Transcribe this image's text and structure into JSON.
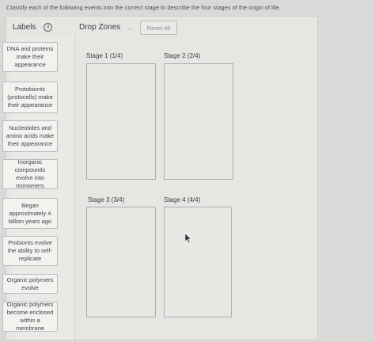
{
  "instructions": "Classify each of the following events into the correct stage to describe the four stages of the origin of life.",
  "labels_panel": {
    "title": "Labels",
    "info_glyph": "i"
  },
  "drop_panel": {
    "title": "Drop Zones",
    "back_glyph": "←",
    "reset_label": "Reset All"
  },
  "labels": [
    "DNA and proteins make their appearance",
    "Protobionts (protocells) make their appearance",
    "Nucleotides and amino acids make their appearance",
    "Inorganic compounds evolve into monomers",
    "Began approximately 4 billion years ago",
    "Probionts evolve the ability to self-replicate",
    "Organic polymers evolve",
    "Organic polymers become enclosed within a membrane"
  ],
  "stages": [
    {
      "label": "Stage 1 (1/4)"
    },
    {
      "label": "Stage 2 (2/4)"
    },
    {
      "label": "Stage 3 (3/4)"
    },
    {
      "label": "Stage 4 (4/4)"
    }
  ],
  "icons": {
    "info": "info-icon",
    "back": "back-arrow-icon",
    "cursor": "mouse-cursor-icon"
  }
}
